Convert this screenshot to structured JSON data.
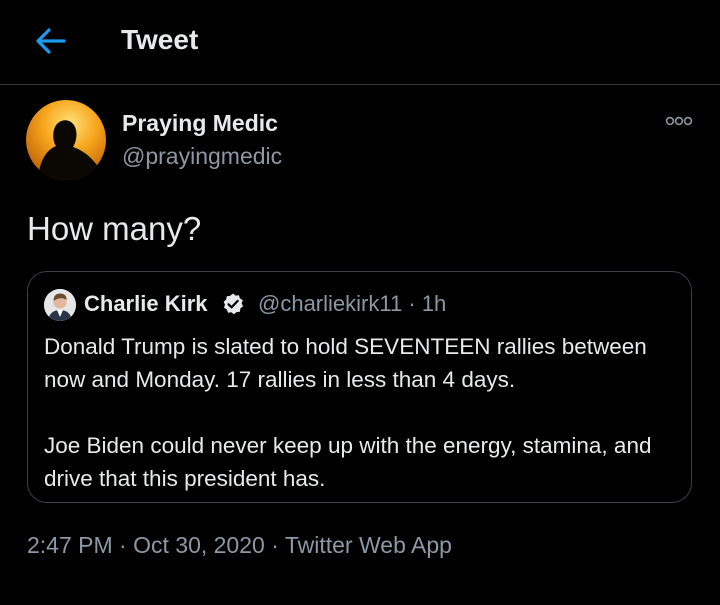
{
  "header": {
    "title": "Tweet",
    "back_icon": "arrow-left-icon",
    "accent": "#1d9bf0"
  },
  "tweet": {
    "author_name": "Praying Medic",
    "author_handle": "@prayingmedic",
    "text": "How many?",
    "timestamp": "2:47 PM",
    "separator": "·",
    "date": "Oct 30, 2020",
    "source": "Twitter Web App"
  },
  "quoted_tweet": {
    "author_name": "Charlie Kirk",
    "verified_icon": "verified-badge-icon",
    "author_handle": "@charliekirk11",
    "separator": "·",
    "age": "1h",
    "paragraphs": [
      "Donald Trump is slated to hold SEVENTEEN rallies between now and Monday. 17 rallies in less than 4 days.",
      "Joe Biden could never keep up with the energy, stamina, and drive that this president has."
    ]
  }
}
